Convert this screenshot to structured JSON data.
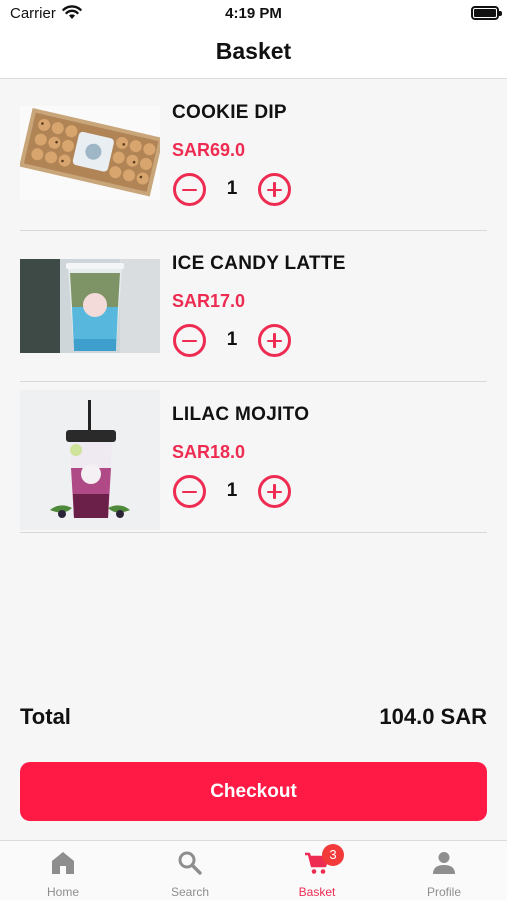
{
  "status_bar": {
    "carrier": "Carrier",
    "time": "4:19 PM"
  },
  "header": {
    "title": "Basket"
  },
  "items": [
    {
      "name": "COOKIE DIP",
      "price": "SAR69.0",
      "quantity": "1",
      "image": "cookie-box-photo"
    },
    {
      "name": "ICE CANDY LATTE",
      "price": "SAR17.0",
      "quantity": "1",
      "image": "layered-iced-latte-photo"
    },
    {
      "name": "LILAC MOJITO",
      "price": "SAR18.0",
      "quantity": "1",
      "image": "purple-mojito-drink-photo"
    }
  ],
  "summary": {
    "total_label": "Total",
    "total_value": "104.0 SAR"
  },
  "checkout": {
    "label": "Checkout"
  },
  "tab_bar": {
    "tabs": [
      {
        "label": "Home",
        "icon": "home-icon"
      },
      {
        "label": "Search",
        "icon": "search-icon"
      },
      {
        "label": "Basket",
        "icon": "cart-icon",
        "badge": "3",
        "active": true
      },
      {
        "label": "Profile",
        "icon": "person-icon"
      }
    ]
  },
  "colors": {
    "accent": "#ee2c52",
    "checkout_bg": "#ff1a46",
    "badge": "#f23a3a"
  }
}
